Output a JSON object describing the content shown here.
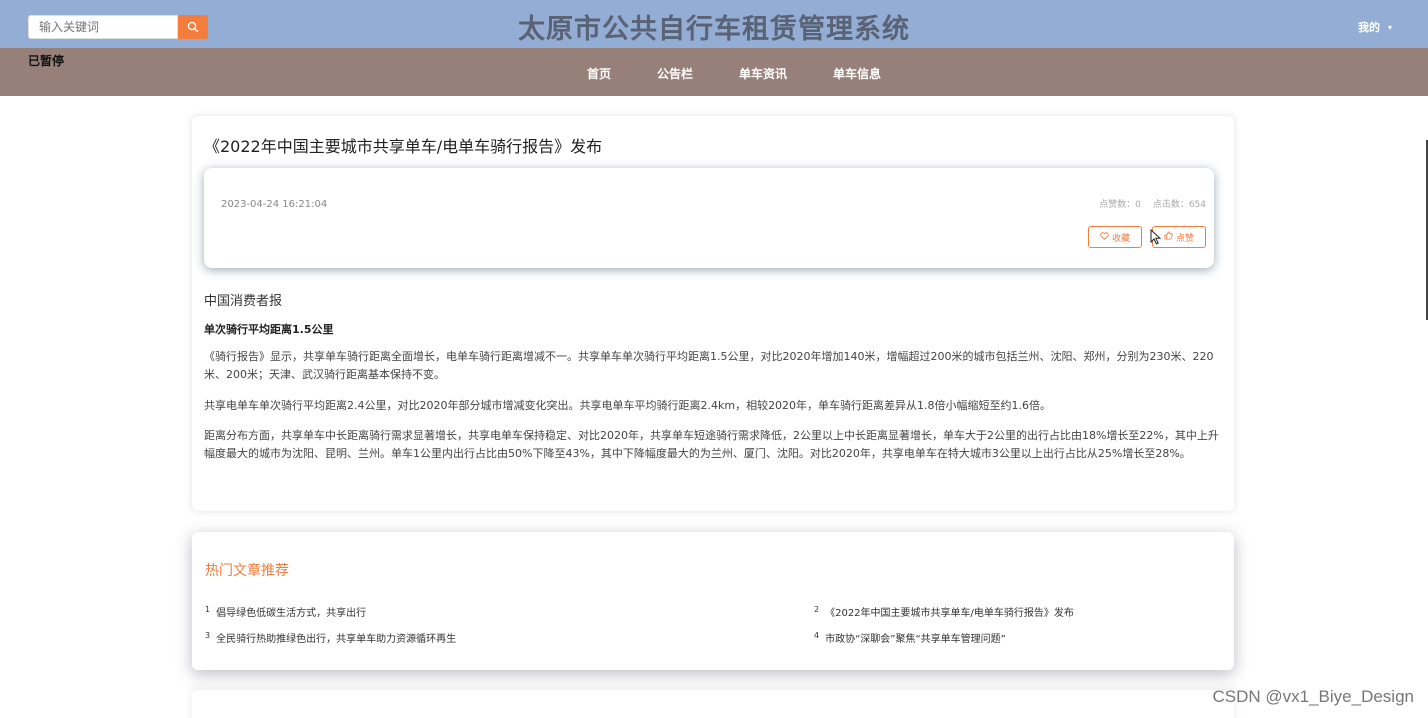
{
  "header": {
    "search_placeholder": "输入关键词",
    "site_title": "太原市公共自行车租赁管理系统",
    "user_menu_label": "我的",
    "caret": "▾"
  },
  "nav": {
    "status_label": "已暂停",
    "links": [
      "首页",
      "公告栏",
      "单车资讯",
      "单车信息"
    ]
  },
  "article": {
    "title": "《2022年中国主要城市共享单车/电单车骑行报告》发布",
    "date": "2023-04-24 16:21:04",
    "likes_label": "点赞数：0",
    "clicks_label": "点击数：654",
    "favorite_label": "收藏",
    "like_label": "点赞",
    "source": "中国消费者报",
    "subheading": "单次骑行平均距离1.5公里",
    "paragraphs": [
      "《骑行报告》显示，共享单车骑行距离全面增长，电单车骑行距离增减不一。共享单车单次骑行平均距离1.5公里，对比2020年增加140米，增幅超过200米的城市包括兰州、沈阳、郑州，分别为230米、220米、200米；天津、武汉骑行距离基本保持不变。",
      "共享电单车单次骑行平均距离2.4公里，对比2020年部分城市增减变化突出。共享电单车平均骑行距离2.4km，相较2020年，单车骑行距离差异从1.8倍小幅缩短至约1.6倍。",
      "距离分布方面，共享单车中长距离骑行需求显著增长，共享电单车保持稳定、对比2020年，共享单车短途骑行需求降低，2公里以上中长距离显著增长，单车大于2公里的出行占比由18%增长至22%，其中上升幅度最大的城市为沈阳、昆明、兰州。单车1公里内出行占比由50%下降至43%，其中下降幅度最大的为兰州、厦门、沈阳。对比2020年，共享电单车在特大城市3公里以上出行占比从25%增长至28%。"
    ]
  },
  "hot": {
    "title": "热门文章推荐",
    "items": [
      {
        "num": "1",
        "text": "倡导绿色低碳生活方式，共享出行"
      },
      {
        "num": "2",
        "text": "《2022年中国主要城市共享单车/电单车骑行报告》发布"
      },
      {
        "num": "3",
        "text": "全民骑行热助推绿色出行，共享单车助力资源循环再生"
      },
      {
        "num": "4",
        "text": "市政协“深聊会”聚焦“共享单车管理问题”"
      }
    ]
  },
  "watermark": "CSDN @vx1_Biye_Design",
  "colors": {
    "header_bg": "#93add4",
    "nav_bg": "#978079",
    "accent": "#f47c3c"
  }
}
